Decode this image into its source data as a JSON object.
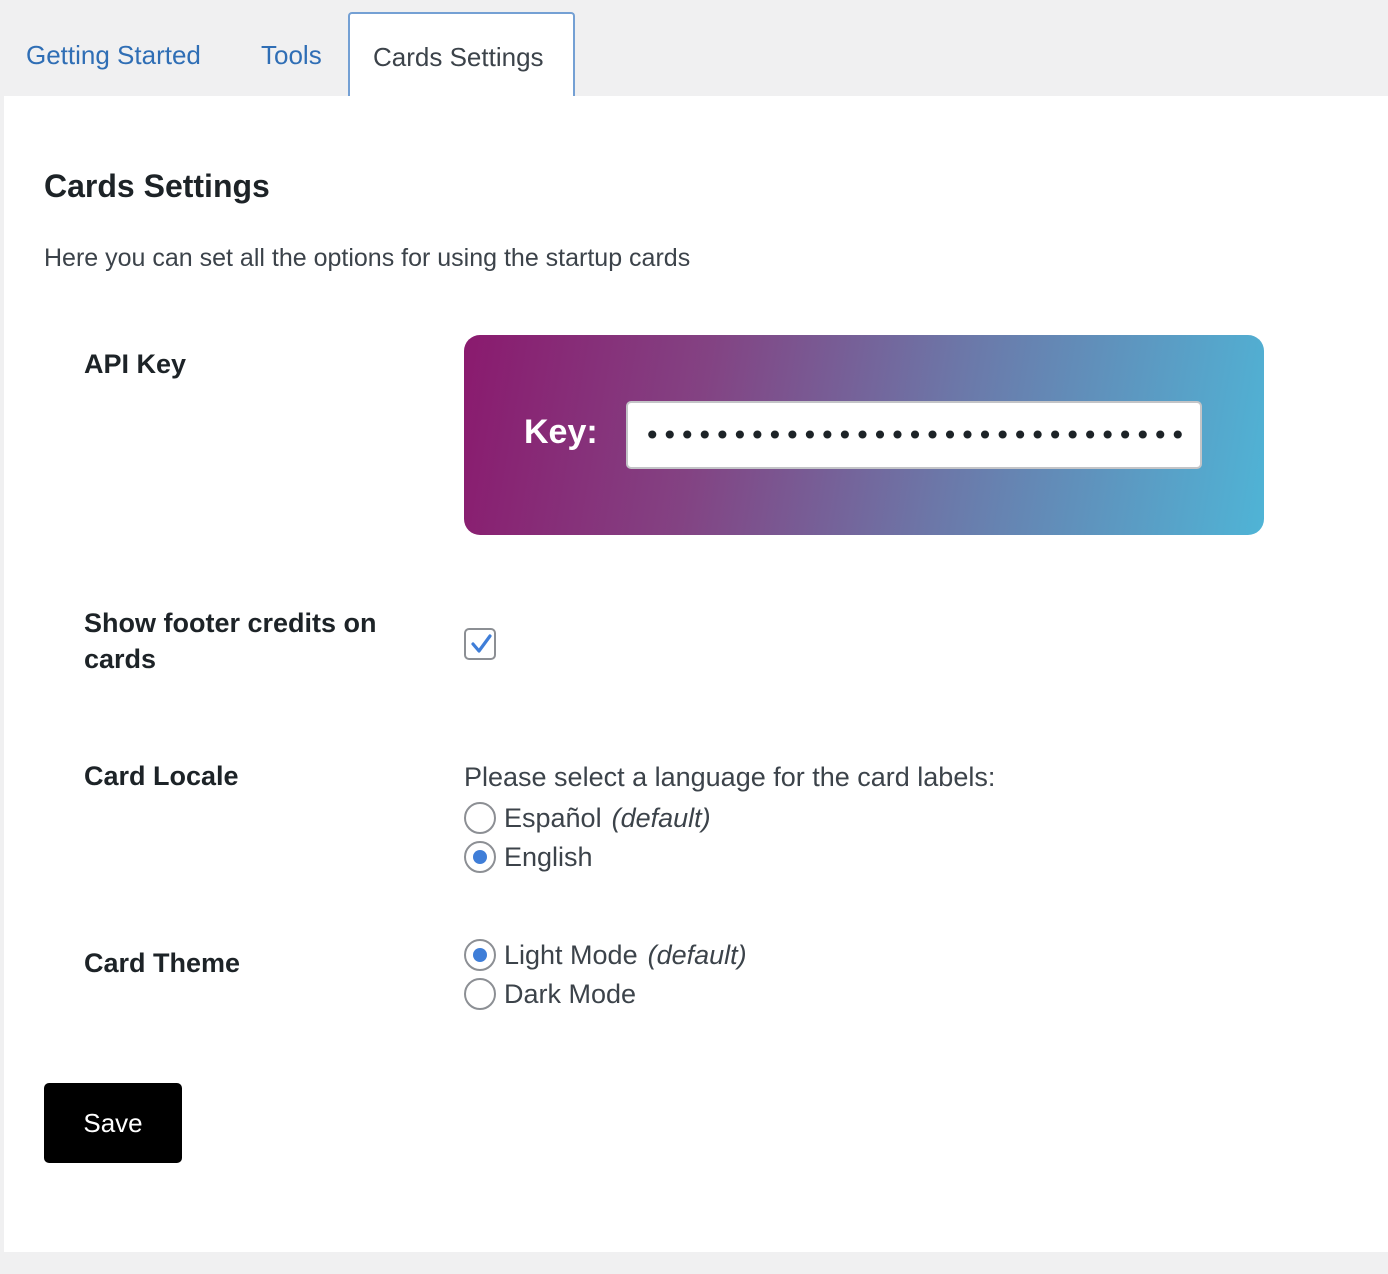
{
  "tabs": [
    {
      "label": "Getting Started",
      "active": false
    },
    {
      "label": "Tools",
      "active": false
    },
    {
      "label": "Cards Settings",
      "active": true
    }
  ],
  "page": {
    "title": "Cards Settings",
    "intro": "Here you can set all the options for using the startup cards"
  },
  "fields": {
    "api_key": {
      "label": "API Key",
      "card_label": "Key:",
      "value": "••••••••••••••••••••••••••••••••••••",
      "gradient": [
        "#8a1a6e",
        "#4fb4d6"
      ]
    },
    "footer_credits": {
      "label": "Show footer credits on cards",
      "checked": true
    },
    "locale": {
      "label": "Card Locale",
      "help": "Please select a language for the card labels:",
      "options": [
        {
          "label": "Español",
          "note": "(default)",
          "checked": false
        },
        {
          "label": "English",
          "note": "",
          "checked": true
        }
      ]
    },
    "theme": {
      "label": "Card Theme",
      "options": [
        {
          "label": "Light Mode",
          "note": "(default)",
          "checked": true
        },
        {
          "label": "Dark Mode",
          "note": "",
          "checked": false
        }
      ]
    }
  },
  "actions": {
    "save_label": "Save"
  },
  "colors": {
    "link": "#2f6eb5",
    "accent": "#3f7ed8",
    "button": "#000000"
  }
}
